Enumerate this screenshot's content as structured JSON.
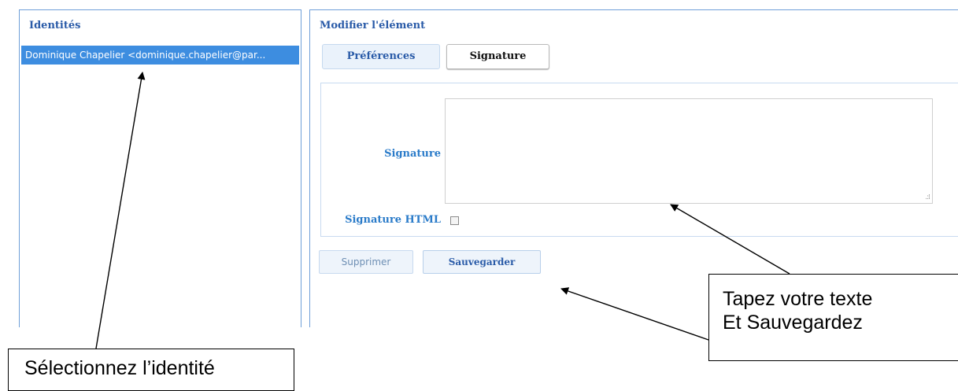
{
  "identities_panel": {
    "title": "Identités",
    "selected_identity": "Dominique Chapelier <dominique.chapelier@par..."
  },
  "edit_panel": {
    "title": "Modifier l'élément",
    "tabs": [
      {
        "label": "Préférences",
        "active": false
      },
      {
        "label": "Signature",
        "active": true
      }
    ],
    "signature_label": "Signature",
    "signature_value": "",
    "html_label": "Signature HTML",
    "html_checked": false,
    "delete_button": "Supprimer",
    "save_button": "Sauvegarder"
  },
  "callouts": {
    "type_line1": "Tapez votre texte",
    "type_line2": "Et Sauvegardez",
    "select": "Sélectionnez l’identité"
  },
  "colors": {
    "accent": "#2a5ba8",
    "selection": "#3d8de0",
    "border": "#6f9fd8"
  }
}
